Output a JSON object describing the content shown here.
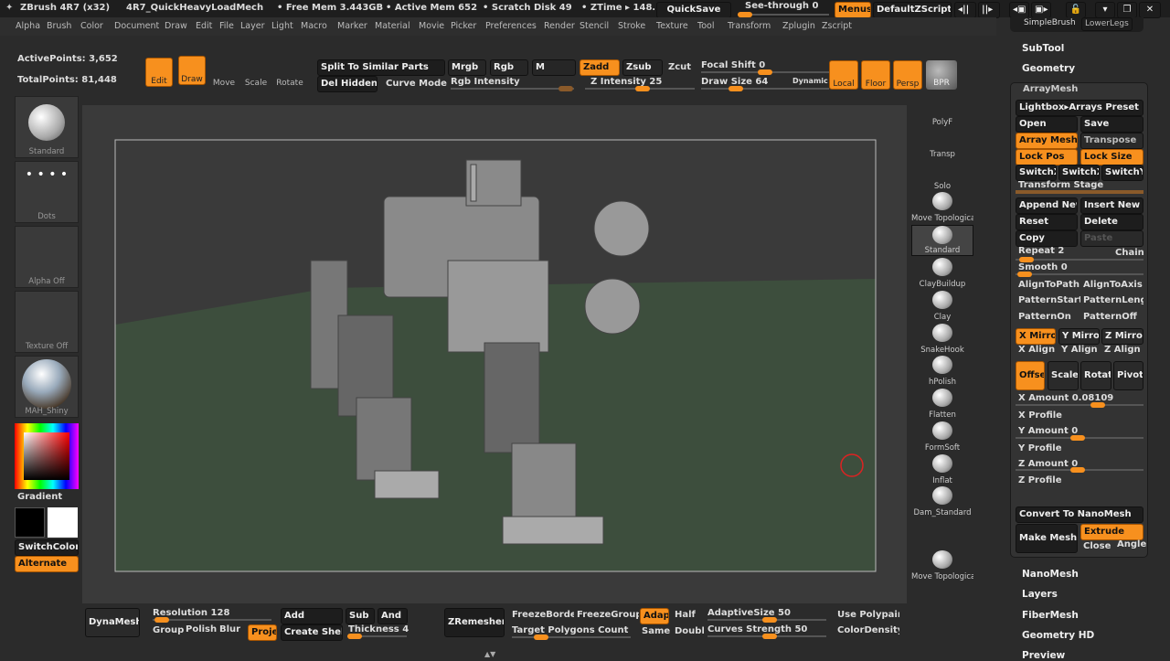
{
  "title_bar": {
    "app": "ZBrush 4R7 (x32)",
    "project": "4R7_QuickHeavyLoadMech",
    "free_mem": "• Free Mem 3.443GB",
    "active_mem": "• Active Mem 652",
    "scratch": "• Scratch Disk 49",
    "ztime": "• ZTime ▸ 148.",
    "quicksave": "QuickSave",
    "see_through": "See-through  0",
    "see_through_value": 0,
    "menus": "Menus",
    "default_script": "DefaultZScript",
    "simple_brush": "SimpleBrush",
    "lower_legs": "LowerLegs"
  },
  "menu": [
    "Alpha",
    "Brush",
    "Color",
    "Document",
    "Draw",
    "Edit",
    "File",
    "Layer",
    "Light",
    "Macro",
    "Marker",
    "Material",
    "Movie",
    "Picker",
    "Preferences",
    "Render",
    "Stencil",
    "Stroke",
    "Texture",
    "Tool",
    "Transform",
    "Zplugin",
    "Zscript"
  ],
  "stats": {
    "active": "ActivePoints: 3,652",
    "total": "TotalPoints: 81,448"
  },
  "top_shelf": {
    "edit": "Edit",
    "draw": "Draw",
    "move": "Move",
    "scale": "Scale",
    "rotate": "Rotate",
    "split": "Split To Similar Parts",
    "mrgb": "Mrgb",
    "rgb": "Rgb",
    "m": "M",
    "zadd": "Zadd",
    "zsub": "Zsub",
    "zcut": "Zcut",
    "del_hidden": "Del Hidden",
    "curve_mode": "Curve Mode",
    "rgb_intensity": "Rgb Intensity",
    "z_intensity": "Z Intensity 25",
    "focal_shift": "Focal Shift 0",
    "draw_size": "Draw Size 64",
    "dynamic": "Dynamic",
    "local": "Local",
    "floor": "Floor",
    "persp": "Persp",
    "bpr": "BPR",
    "z_intensity_value": 25,
    "focal_shift_value": 0,
    "draw_size_value": 64
  },
  "left_shelf": {
    "brush": "Standard",
    "stroke": "Dots",
    "alpha": "Alpha Off",
    "texture": "Texture Off",
    "material": "MAH_Shiny",
    "gradient": "Gradient",
    "switch_color": "SwitchColor",
    "alternate": "Alternate"
  },
  "right_shelf": [
    "PolyF",
    "Transp",
    "Solo",
    "Move Topological",
    "Standard",
    "ClayBuildup",
    "Clay",
    "SnakeHook",
    "hPolish",
    "Flatten",
    "FormSoft",
    "Inflat",
    "Dam_Standard",
    "Move Topological"
  ],
  "tool_panel": {
    "subtool": "SubTool",
    "geometry": "Geometry",
    "arraymesh": "ArrayMesh",
    "lightbox": "Lightbox▸Arrays Preset",
    "open": "Open",
    "save": "Save",
    "array_mesh": "Array Mesh",
    "transpose": "Transpose",
    "lock_pos": "Lock Pos",
    "lock_size": "Lock Size",
    "switchx1": "SwitchX",
    "switchx2": "SwitchX",
    "switchy": "SwitchY",
    "transform_stage": "Transform Stage",
    "append_new": "Append New",
    "insert_new": "Insert New",
    "reset": "Reset",
    "delete": "Delete",
    "copy": "Copy",
    "paste": "Paste",
    "repeat": "Repeat 2",
    "chain": "Chain",
    "smooth": "Smooth 0",
    "align_to_path": "AlignToPath",
    "align_to_axis": "AlignToAxis",
    "pattern_start": "PatternStart",
    "pattern_length": "PatternLength",
    "pattern_on": "PatternOn",
    "pattern_off": "PatternOff",
    "x_mirror": "X Mirror",
    "y_mirror": "Y Mirror",
    "z_mirror": "Z Mirror",
    "x_align": "X Align",
    "y_align": "Y Align",
    "z_align": "Z Align",
    "offset": "Offset",
    "scale": "Scale",
    "rotate": "Rotate",
    "pivot": "Pivot",
    "x_amount": "X Amount 0.08109",
    "x_profile": "X Profile",
    "y_amount": "Y Amount 0",
    "y_profile": "Y Profile",
    "z_amount": "Z Amount 0",
    "z_profile": "Z Profile",
    "convert": "Convert To NanoMesh",
    "make_mesh": "Make Mesh",
    "extrude": "Extrude",
    "close": "Close",
    "angle": "Angle",
    "nanomesh": "NanoMesh",
    "layers": "Layers",
    "fibermesh": "FiberMesh",
    "geometry_hd": "Geometry HD",
    "preview": "Preview"
  },
  "bottom_shelf": {
    "dynamesh": "DynaMesh",
    "resolution": "Resolution 128",
    "group": "Group",
    "polish": "Polish",
    "blur": "Blur",
    "project": "Project",
    "add": "Add",
    "sub": "Sub",
    "and": "And",
    "create_shell": "Create Shell",
    "thickness": "Thickness 4",
    "zremesher": "ZRemesher",
    "freeze_borders": "FreezeBorder",
    "freeze_groups": "FreezeGroups",
    "adapt": "Adapt",
    "half": "Half",
    "same": "Same",
    "double": "Double",
    "adaptive_size": "AdaptiveSize 50",
    "target_polys": "Target Polygons Count",
    "curves_strength": "Curves Strength 50",
    "use_polypaint": "Use Polypaint",
    "color_density": "ColorDensity"
  },
  "colors": {
    "accent": "#f7901e",
    "background": "#2b2b2b",
    "canvas": "#3a3a3a",
    "floor": "#3d4e3d"
  }
}
